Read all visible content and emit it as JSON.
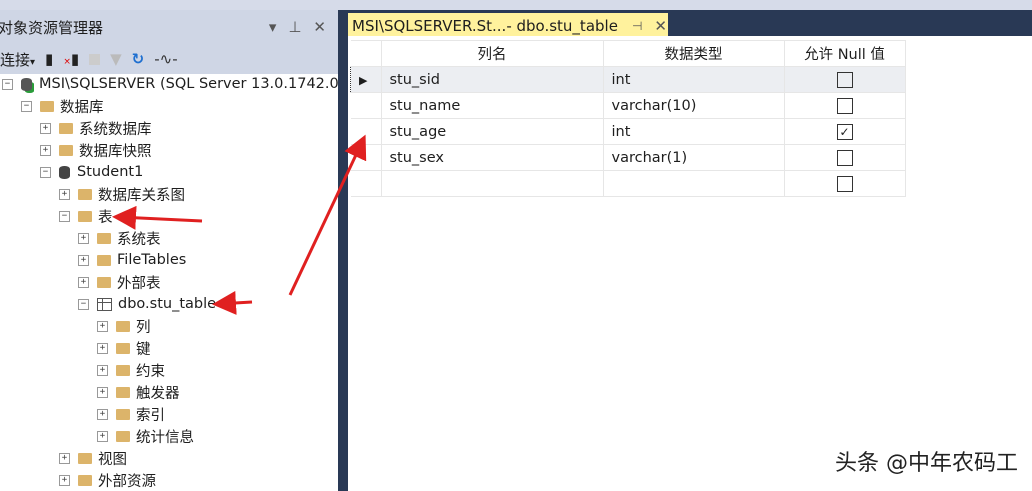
{
  "panel": {
    "title": "对象资源管理器",
    "dropdown": "▾",
    "pin": "⊥",
    "close": "✕"
  },
  "toolbar": {
    "connect": "连接",
    "connect_arrow": "▾"
  },
  "tree": [
    {
      "label": "MSI\\SQLSERVER (SQL Server 13.0.1742.0",
      "level": 0,
      "exp": "−",
      "icon": "server"
    },
    {
      "label": "数据库",
      "level": 1,
      "exp": "−",
      "icon": "folder"
    },
    {
      "label": "系统数据库",
      "level": 2,
      "exp": "+",
      "icon": "folder"
    },
    {
      "label": "数据库快照",
      "level": 2,
      "exp": "+",
      "icon": "folder"
    },
    {
      "label": "Student1",
      "level": 2,
      "exp": "−",
      "icon": "db"
    },
    {
      "label": "数据库关系图",
      "level": 3,
      "exp": "+",
      "icon": "folder"
    },
    {
      "label": "表",
      "level": 3,
      "exp": "−",
      "icon": "folder"
    },
    {
      "label": "系统表",
      "level": 4,
      "exp": "+",
      "icon": "folder"
    },
    {
      "label": "FileTables",
      "level": 4,
      "exp": "+",
      "icon": "folder"
    },
    {
      "label": "外部表",
      "level": 4,
      "exp": "+",
      "icon": "folder"
    },
    {
      "label": "dbo.stu_table",
      "level": 4,
      "exp": "−",
      "icon": "table"
    },
    {
      "label": "列",
      "level": 5,
      "exp": "+",
      "icon": "folder"
    },
    {
      "label": "键",
      "level": 5,
      "exp": "+",
      "icon": "folder"
    },
    {
      "label": "约束",
      "level": 5,
      "exp": "+",
      "icon": "folder"
    },
    {
      "label": "触发器",
      "level": 5,
      "exp": "+",
      "icon": "folder"
    },
    {
      "label": "索引",
      "level": 5,
      "exp": "+",
      "icon": "folder"
    },
    {
      "label": "统计信息",
      "level": 5,
      "exp": "+",
      "icon": "folder"
    },
    {
      "label": "视图",
      "level": 3,
      "exp": "+",
      "icon": "folder"
    },
    {
      "label": "外部资源",
      "level": 3,
      "exp": "+",
      "icon": "folder"
    }
  ],
  "tab": {
    "title": "MSI\\SQLSERVER.St...- dbo.stu_table",
    "pin": "⊣",
    "close": "✕"
  },
  "grid": {
    "headers": [
      "列名",
      "数据类型",
      "允许 Null 值"
    ],
    "rows": [
      {
        "name": "stu_sid",
        "type": "int",
        "null": false
      },
      {
        "name": "stu_name",
        "type": "varchar(10)",
        "null": false
      },
      {
        "name": "stu_age",
        "type": "int",
        "null": true
      },
      {
        "name": "stu_sex",
        "type": "varchar(1)",
        "null": false
      },
      {
        "name": "",
        "type": "",
        "null": false
      }
    ]
  },
  "watermark": "头条 @中年农码工",
  "colors": {
    "annotation": "#e02020",
    "tab": "#fff29d"
  }
}
